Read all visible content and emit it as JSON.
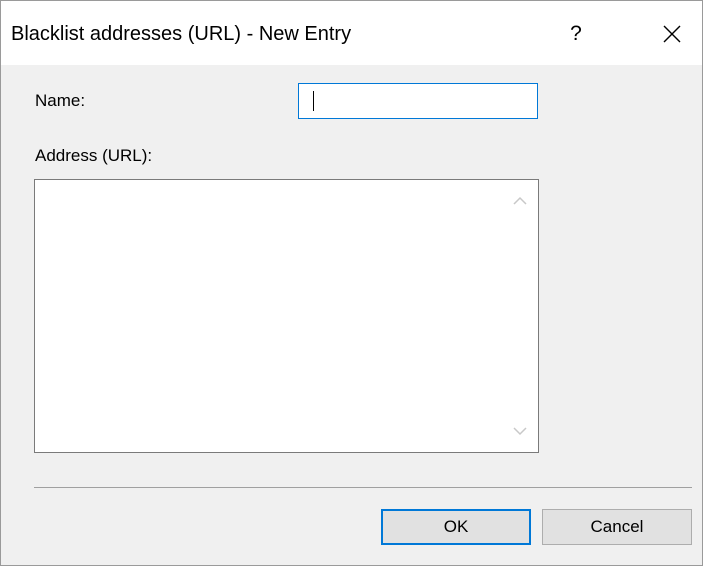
{
  "window": {
    "title": "Blacklist addresses (URL) - New Entry",
    "help_label": "?"
  },
  "form": {
    "name_label": "Name:",
    "name_value": "",
    "address_label": "Address (URL):",
    "address_value": ""
  },
  "buttons": {
    "ok": "OK",
    "cancel": "Cancel"
  },
  "icons": {
    "close": "close-icon",
    "scroll_up": "chevron-up-icon",
    "scroll_down": "chevron-down-icon"
  },
  "colors": {
    "focus_accent": "#0078d7",
    "dialog_background": "#f0f0f0",
    "button_face": "#e1e1e1"
  }
}
